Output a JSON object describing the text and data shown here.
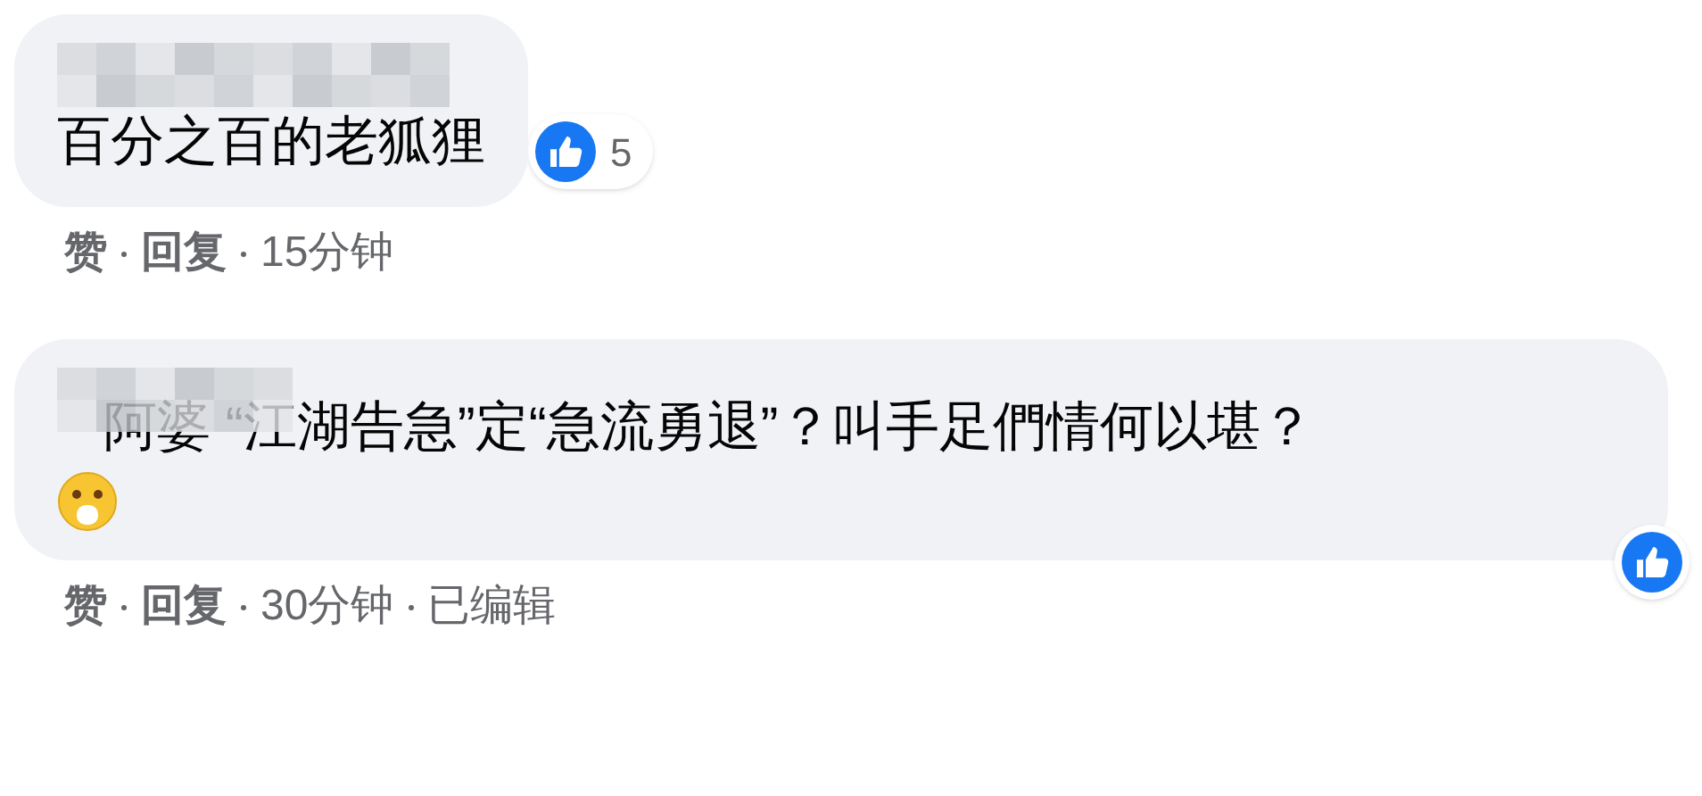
{
  "comments": [
    {
      "text": "百分之百的老狐狸",
      "reaction_count": "5",
      "actions": [
        "赞",
        "回复"
      ],
      "time": "15分钟"
    },
    {
      "text": "阿婆 “江湖告急”定“急流勇退”？叫手足們情何以堪？",
      "emoji": true,
      "actions": [
        "赞",
        "回复"
      ],
      "time": "30分钟",
      "edited": "已编辑"
    }
  ]
}
